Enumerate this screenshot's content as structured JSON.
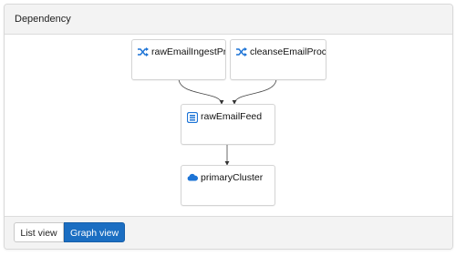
{
  "panel": {
    "title": "Dependency"
  },
  "nodes": {
    "ingest": {
      "label": "rawEmailIngestPro",
      "icon": "shuffle-icon"
    },
    "cleanse": {
      "label": "cleanseEmailProce",
      "icon": "shuffle-icon"
    },
    "feed": {
      "label": "rawEmailFeed",
      "icon": "feed-icon"
    },
    "cluster": {
      "label": "primaryCluster",
      "icon": "cloud-icon"
    }
  },
  "footer": {
    "list_view": "List view",
    "graph_view": "Graph view",
    "active_view": "Graph view"
  },
  "colors": {
    "accent": "#1b6ec2",
    "icon": "#1d74d6"
  }
}
